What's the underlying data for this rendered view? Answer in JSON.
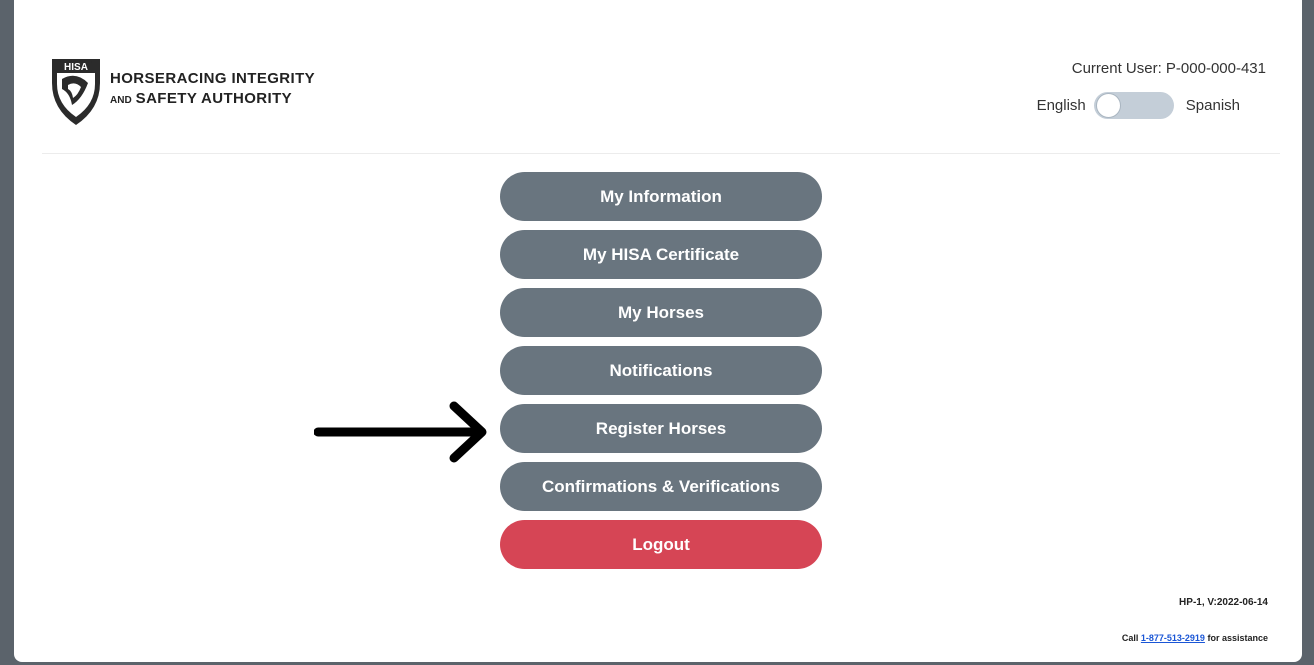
{
  "header": {
    "logo_badge": "HISA",
    "logo_line1": "HORSERACING INTEGRITY",
    "logo_line2_prefix": "AND",
    "logo_line2_main": "SAFETY AUTHORITY",
    "current_user": "Current User: P-000-000-431",
    "lang_left": "English",
    "lang_right": "Spanish",
    "toggle_state": "English"
  },
  "menu": {
    "items": [
      {
        "label": "My Information"
      },
      {
        "label": "My HISA Certificate"
      },
      {
        "label": "My Horses"
      },
      {
        "label": "Notifications"
      },
      {
        "label": "Register Horses"
      },
      {
        "label": "Confirmations & Verifications"
      },
      {
        "label": "Logout"
      }
    ]
  },
  "footer": {
    "version": "HP-1, V:2022-06-14",
    "help_prefix": "Call",
    "phone": "1-877-513-2919",
    "help_suffix": "for assistance"
  },
  "colors": {
    "button_gray": "#69757f",
    "button_logout": "#d64555",
    "toggle_track": "#c4ced8",
    "link": "#1a56d6"
  },
  "icons": {
    "logo": "hisa-shield-logo",
    "annotation": "arrow-right-icon"
  }
}
